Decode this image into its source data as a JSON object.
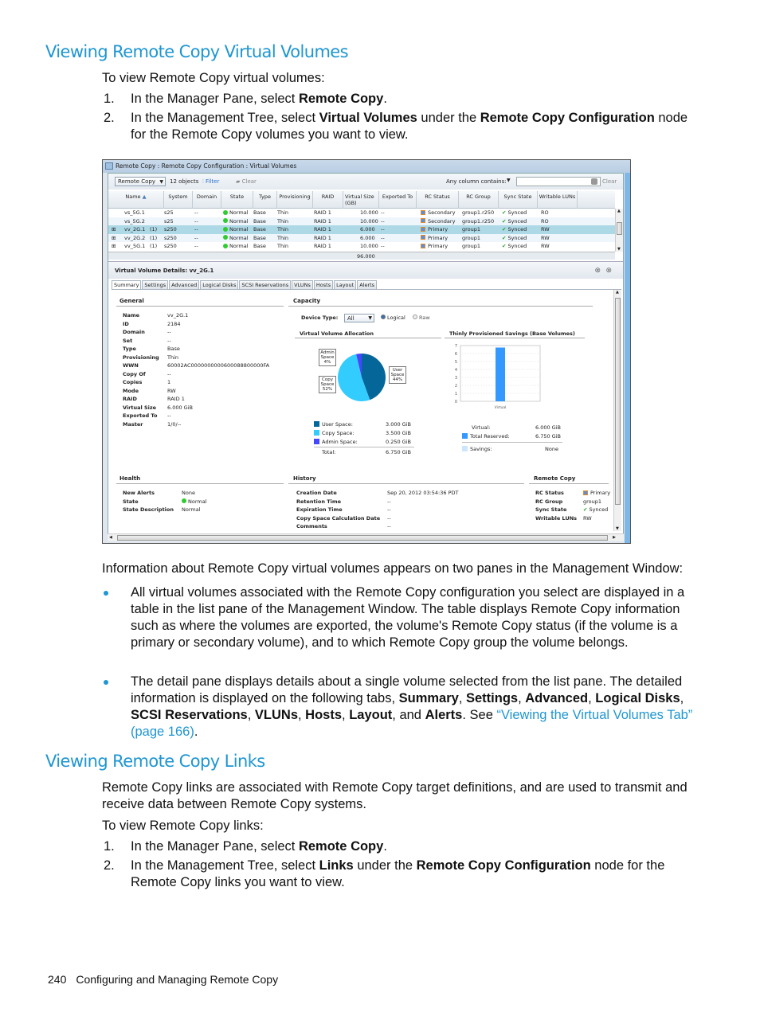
{
  "section1": {
    "heading": "Viewing Remote Copy Virtual Volumes",
    "intro": "To view Remote Copy virtual volumes:",
    "steps": [
      {
        "num": "1.",
        "pre": "In the Manager Pane, select ",
        "bold1": "Remote Copy",
        "post": "."
      },
      {
        "num": "2.",
        "pre": "In the Management Tree, select ",
        "bold1": "Virtual Volumes",
        "mid": " under the ",
        "bold2": "Remote Copy Configuration",
        "post": " node for the Remote Copy volumes you want to view."
      }
    ]
  },
  "app": {
    "title": "Remote Copy : Remote Copy Configuration : Virtual Volumes",
    "toolbar": {
      "view_select": "Remote Copy",
      "object_count": "12 objects",
      "filter_label": "Filter",
      "clear_label": "Clear",
      "search_label": "Any column contains:",
      "search_value": "",
      "search_clear": "Clear"
    },
    "columns": [
      "Name",
      "System",
      "Domain",
      "State",
      "Type",
      "Provisioning",
      "RAID",
      "Virtual Size (GB)",
      "Exported To",
      "RC Status",
      "RC Group",
      "Sync State",
      "Writable LUNs"
    ],
    "rows": [
      {
        "expand": "",
        "name": "vs_5G.1",
        "count": "",
        "system": "s25",
        "domain": "--",
        "state": "Normal",
        "type": "Base",
        "prov": "Thin",
        "raid": "RAID 1",
        "vsize": "10.000",
        "exported": "--",
        "rc_status": "Secondary",
        "rc_group": "group1.r250",
        "sync": "Synced",
        "wluns": "RO"
      },
      {
        "expand": "",
        "name": "vs_5G.2",
        "count": "",
        "system": "s25",
        "domain": "--",
        "state": "Normal",
        "type": "Base",
        "prov": "Thin",
        "raid": "RAID 1",
        "vsize": "10.000",
        "exported": "--",
        "rc_status": "Secondary",
        "rc_group": "group1.r250",
        "sync": "Synced",
        "wluns": "RO"
      },
      {
        "expand": "+",
        "name": "vv_2G.1",
        "count": "(1)",
        "system": "s250",
        "domain": "--",
        "state": "Normal",
        "type": "Base",
        "prov": "Thin",
        "raid": "RAID 1",
        "vsize": "6.000",
        "exported": "--",
        "rc_status": "Primary",
        "rc_group": "group1",
        "sync": "Synced",
        "wluns": "RW"
      },
      {
        "expand": "+",
        "name": "vv_2G.2",
        "count": "(1)",
        "system": "s250",
        "domain": "--",
        "state": "Normal",
        "type": "Base",
        "prov": "Thin",
        "raid": "RAID 1",
        "vsize": "6.000",
        "exported": "--",
        "rc_status": "Primary",
        "rc_group": "group1",
        "sync": "Synced",
        "wluns": "RW"
      },
      {
        "expand": "+",
        "name": "vv_5G.1",
        "count": "(1)",
        "system": "s250",
        "domain": "--",
        "state": "Normal",
        "type": "Base",
        "prov": "Thin",
        "raid": "RAID 1",
        "vsize": "10.000",
        "exported": "--",
        "rc_status": "Primary",
        "rc_group": "group1",
        "sync": "Synced",
        "wluns": "RW"
      }
    ],
    "total_vsize": "96.000",
    "detail_title": "Virtual Volume Details: vv_2G.1",
    "tabs": [
      "Summary",
      "Settings",
      "Advanced",
      "Logical Disks",
      "SCSI Reservations",
      "VLUNs",
      "Hosts",
      "Layout",
      "Alerts"
    ],
    "general": {
      "title": "General",
      "items": [
        {
          "k": "Name",
          "v": "vv_2G.1"
        },
        {
          "k": "ID",
          "v": "2184"
        },
        {
          "k": "Domain",
          "v": "--"
        },
        {
          "k": "Set",
          "v": "--"
        },
        {
          "k": "Type",
          "v": "Base"
        },
        {
          "k": "Provisioning",
          "v": "Thin"
        },
        {
          "k": "WWN",
          "v": "60002AC0000000000600088800000FA"
        },
        {
          "k": "Copy Of",
          "v": "--"
        },
        {
          "k": "Copies",
          "v": "1"
        },
        {
          "k": "Mode",
          "v": "RW"
        },
        {
          "k": "RAID",
          "v": "RAID 1"
        },
        {
          "k": "Virtual Size",
          "v": "6.000 GiB"
        },
        {
          "k": "Exported To",
          "v": "--"
        },
        {
          "k": "Master",
          "v": "1/0/--"
        }
      ]
    },
    "capacity": {
      "title": "Capacity",
      "device_type_label": "Device Type:",
      "device_type_value": "All",
      "radio_logical": "Logical",
      "radio_raw": "Raw",
      "allocation_title": "Virtual Volume Allocation",
      "savings_title": "Thinly Provisioned Savings (Base Volumes)",
      "legend": [
        {
          "label": "User Space:",
          "value": "3.000 GiB",
          "color": "#05669a"
        },
        {
          "label": "Copy Space:",
          "value": "3.500 GiB",
          "color": "#33ccff"
        },
        {
          "label": "Admin Space:",
          "value": "0.250 GiB",
          "color": "#4646ff"
        }
      ],
      "total_label": "Total:",
      "total_value": "6.750 GiB",
      "pie_labels": [
        "Admin Space 4%",
        "Copy Space 52%",
        "User Space 44%"
      ],
      "savings_legend": [
        {
          "label": "Virtual:",
          "value": "6.000 GiB"
        },
        {
          "label": "Total Reserved:",
          "value": "6.750 GiB"
        },
        {
          "label": "Savings:",
          "value": "None"
        }
      ]
    },
    "health": {
      "title": "Health",
      "items": [
        {
          "k": "New Alerts",
          "v": "None"
        },
        {
          "k": "State",
          "v": "Normal"
        },
        {
          "k": "State Description",
          "v": "Normal"
        }
      ]
    },
    "history": {
      "title": "History",
      "items": [
        {
          "k": "Creation Date",
          "v": "Sep 20, 2012 03:54:36 PDT"
        },
        {
          "k": "Retention Time",
          "v": "--"
        },
        {
          "k": "Expiration Time",
          "v": "--"
        },
        {
          "k": "Copy Space Calculation Date",
          "v": "--"
        },
        {
          "k": "Comments",
          "v": "--"
        }
      ]
    },
    "remote_copy": {
      "title": "Remote Copy",
      "items": [
        {
          "k": "RC Status",
          "v": "Primary"
        },
        {
          "k": "RC Group",
          "v": "group1"
        },
        {
          "k": "Sync State",
          "v": "Synced"
        },
        {
          "k": "Writable LUNs",
          "v": "RW"
        }
      ]
    }
  },
  "chart_data": [
    {
      "type": "pie",
      "title": "Virtual Volume Allocation",
      "categories": [
        "User Space",
        "Copy Space",
        "Admin Space"
      ],
      "values": [
        3.0,
        3.5,
        0.25
      ],
      "percent_labels": [
        "44%",
        "52%",
        "4%"
      ],
      "colors": [
        "#05669a",
        "#33ccff",
        "#4646ff"
      ]
    },
    {
      "type": "bar",
      "title": "Thinly Provisioned Savings (Base Volumes)",
      "categories": [
        "Virtual"
      ],
      "values": [
        6.75
      ],
      "ylim": [
        0,
        7
      ],
      "yticks": [
        0,
        1,
        2,
        3,
        4,
        5,
        6,
        7
      ],
      "color": "#3399ff",
      "grid": true
    }
  ],
  "after": {
    "intro": "Information about Remote Copy virtual volumes appears on two panes in the Management Window:",
    "bullet1": "All virtual volumes associated with the Remote Copy configuration you select are displayed in a table in the list pane of the Management Window. The table displays Remote Copy information such as where the volumes are exported, the volume's Remote Copy status (if the volume is a primary or secondary volume), and to which Remote Copy group the volume belongs.",
    "bullet2": {
      "pre": "The detail pane displays details about a single volume selected from the list pane. The detailed information is displayed on the following tabs, ",
      "tabs": [
        "Summary",
        "Settings",
        "Advanced",
        "Logical Disks",
        "SCSI Reservations",
        "VLUNs",
        "Hosts",
        "Layout",
        "Alerts"
      ],
      "see": ". See ",
      "link": "“Viewing the Virtual Volumes Tab” (page 166)",
      "end": "."
    }
  },
  "section2": {
    "heading": "Viewing Remote Copy Links",
    "para": "Remote Copy links are associated with Remote Copy target definitions, and are used to transmit and receive data between Remote Copy systems.",
    "intro": "To view Remote Copy links:",
    "steps": [
      {
        "num": "1.",
        "pre": "In the Manager Pane, select ",
        "bold1": "Remote Copy",
        "post": "."
      },
      {
        "num": "2.",
        "pre": "In the Management Tree, select ",
        "bold1": "Links",
        "mid": " under the ",
        "bold2": "Remote Copy Configuration",
        "post": " node for the Remote Copy links you want to view."
      }
    ]
  },
  "footer": {
    "page_number": "240",
    "chapter": "Configuring and Managing Remote Copy"
  }
}
